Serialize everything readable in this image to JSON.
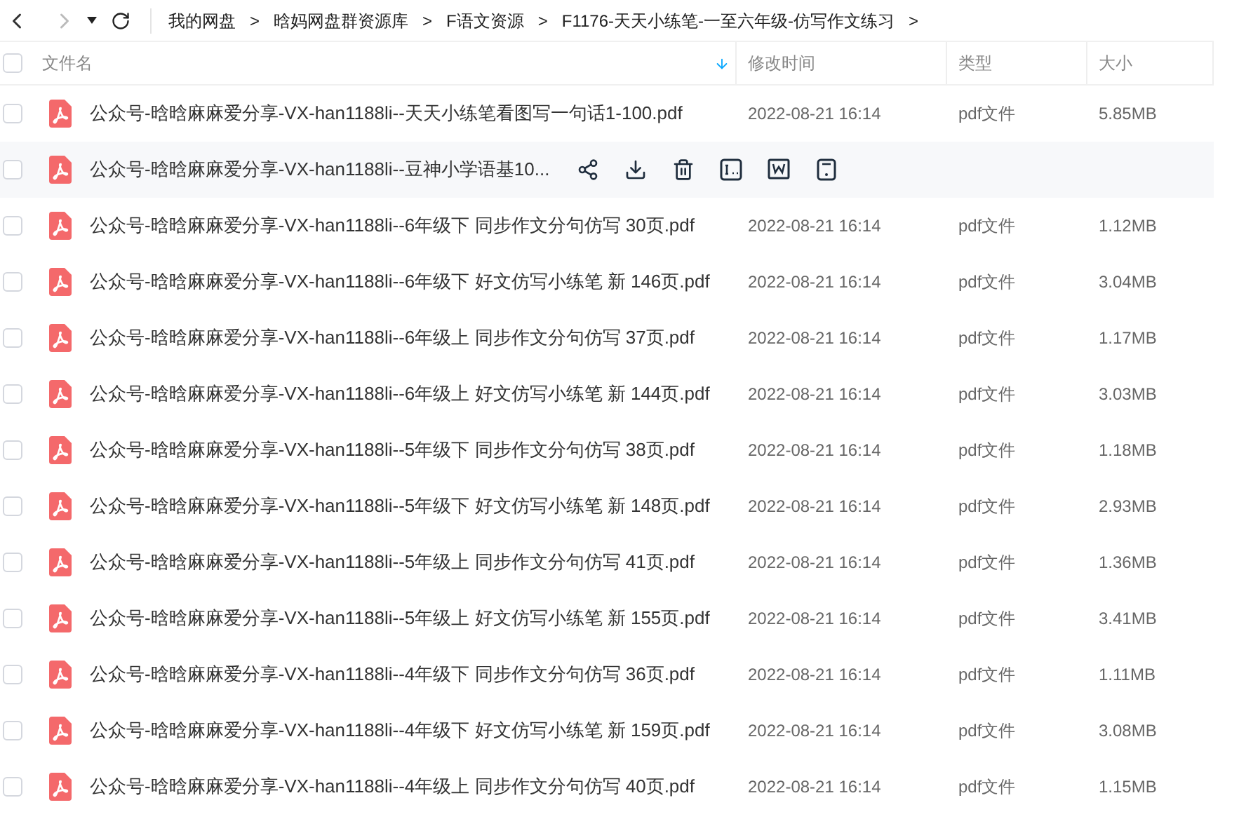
{
  "breadcrumb": [
    "我的网盘",
    "晗妈网盘群资源库",
    "F语文资源",
    "F1176-天天小练笔-一至六年级-仿写作文练习"
  ],
  "breadcrumb_separator": ">",
  "forward_disabled": true,
  "select_all_checked": false,
  "columns": [
    {
      "label": "文件名",
      "sorted": true
    },
    {
      "label": "修改时间",
      "sorted": false
    },
    {
      "label": "类型",
      "sorted": false
    },
    {
      "label": "大小",
      "sorted": false
    }
  ],
  "rows": [
    {
      "name": "公众号-晗晗麻麻爱分享-VX-han1188li--天天小练笔看图写一句话1-100.pdf",
      "hovered": false,
      "checked": false,
      "modified": "2022-08-21 16:14",
      "type": "pdf文件",
      "size": "5.85MB"
    },
    {
      "name": "公众号-晗晗麻麻爱分享-VX-han1188li--豆神小学语基10...",
      "hovered": true,
      "checked": false
    },
    {
      "name": "公众号-晗晗麻麻爱分享-VX-han1188li--6年级下 同步作文分句仿写 30页.pdf",
      "hovered": false,
      "checked": false,
      "modified": "2022-08-21 16:14",
      "type": "pdf文件",
      "size": "1.12MB"
    },
    {
      "name": "公众号-晗晗麻麻爱分享-VX-han1188li--6年级下 好文仿写小练笔 新 146页.pdf",
      "hovered": false,
      "checked": false,
      "modified": "2022-08-21 16:14",
      "type": "pdf文件",
      "size": "3.04MB"
    },
    {
      "name": "公众号-晗晗麻麻爱分享-VX-han1188li--6年级上 同步作文分句仿写 37页.pdf",
      "hovered": false,
      "checked": false,
      "modified": "2022-08-21 16:14",
      "type": "pdf文件",
      "size": "1.17MB"
    },
    {
      "name": "公众号-晗晗麻麻爱分享-VX-han1188li--6年级上 好文仿写小练笔 新 144页.pdf",
      "hovered": false,
      "checked": false,
      "modified": "2022-08-21 16:14",
      "type": "pdf文件",
      "size": "3.03MB"
    },
    {
      "name": "公众号-晗晗麻麻爱分享-VX-han1188li--5年级下 同步作文分句仿写 38页.pdf",
      "hovered": false,
      "checked": false,
      "modified": "2022-08-21 16:14",
      "type": "pdf文件",
      "size": "1.18MB"
    },
    {
      "name": "公众号-晗晗麻麻爱分享-VX-han1188li--5年级下 好文仿写小练笔 新 148页.pdf",
      "hovered": false,
      "checked": false,
      "modified": "2022-08-21 16:14",
      "type": "pdf文件",
      "size": "2.93MB"
    },
    {
      "name": "公众号-晗晗麻麻爱分享-VX-han1188li--5年级上 同步作文分句仿写 41页.pdf",
      "hovered": false,
      "checked": false,
      "modified": "2022-08-21 16:14",
      "type": "pdf文件",
      "size": "1.36MB"
    },
    {
      "name": "公众号-晗晗麻麻爱分享-VX-han1188li--5年级上 好文仿写小练笔 新 155页.pdf",
      "hovered": false,
      "checked": false,
      "modified": "2022-08-21 16:14",
      "type": "pdf文件",
      "size": "3.41MB"
    },
    {
      "name": "公众号-晗晗麻麻爱分享-VX-han1188li--4年级下 同步作文分句仿写 36页.pdf",
      "hovered": false,
      "checked": false,
      "modified": "2022-08-21 16:14",
      "type": "pdf文件",
      "size": "1.11MB"
    },
    {
      "name": "公众号-晗晗麻麻爱分享-VX-han1188li--4年级下 好文仿写小练笔 新 159页.pdf",
      "hovered": false,
      "checked": false,
      "modified": "2022-08-21 16:14",
      "type": "pdf文件",
      "size": "3.08MB"
    },
    {
      "name": "公众号-晗晗麻麻爱分享-VX-han1188li--4年级上 同步作文分句仿写 40页.pdf",
      "hovered": false,
      "checked": false,
      "modified": "2022-08-21 16:14",
      "type": "pdf文件",
      "size": "1.15MB"
    }
  ]
}
